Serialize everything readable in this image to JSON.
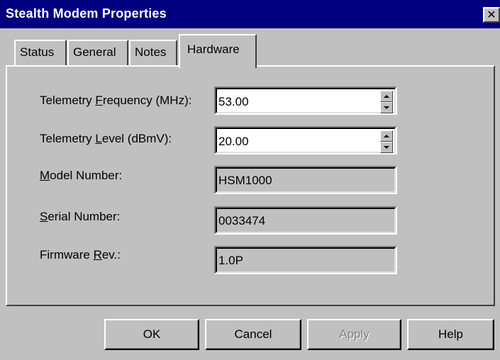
{
  "window": {
    "title": "Stealth Modem Properties",
    "close_glyph": "✕"
  },
  "tabs": [
    {
      "label": "Status",
      "active": false
    },
    {
      "label": "General",
      "active": false
    },
    {
      "label": "Notes",
      "active": false
    },
    {
      "label": "Hardware",
      "active": true
    }
  ],
  "hardware": {
    "telemetry_frequency": {
      "label_pre": "Telemetry ",
      "label_key": "F",
      "label_post": "requency (MHz):",
      "value": "53.00"
    },
    "telemetry_level": {
      "label_pre": "Telemetry ",
      "label_key": "L",
      "label_post": "evel (dBmV):",
      "value": "20.00"
    },
    "model_number": {
      "label_pre": "",
      "label_key": "M",
      "label_post": "odel Number:",
      "value": "HSM1000"
    },
    "serial_number": {
      "label_pre": "",
      "label_key": "S",
      "label_post": "erial Number:",
      "value": "0033474"
    },
    "firmware_rev": {
      "label_pre": "Firmware ",
      "label_key": "R",
      "label_post": "ev.:",
      "value": "1.0P"
    }
  },
  "buttons": {
    "ok": "OK",
    "cancel": "Cancel",
    "apply": "Apply",
    "help": "Help"
  },
  "colors": {
    "titlebar": "#000080",
    "face": "#c0c0c0",
    "disabled_text": "#808080"
  },
  "icons": {
    "close": "close-icon",
    "spin_up": "spin-up-arrow-icon",
    "spin_down": "spin-down-arrow-icon"
  }
}
